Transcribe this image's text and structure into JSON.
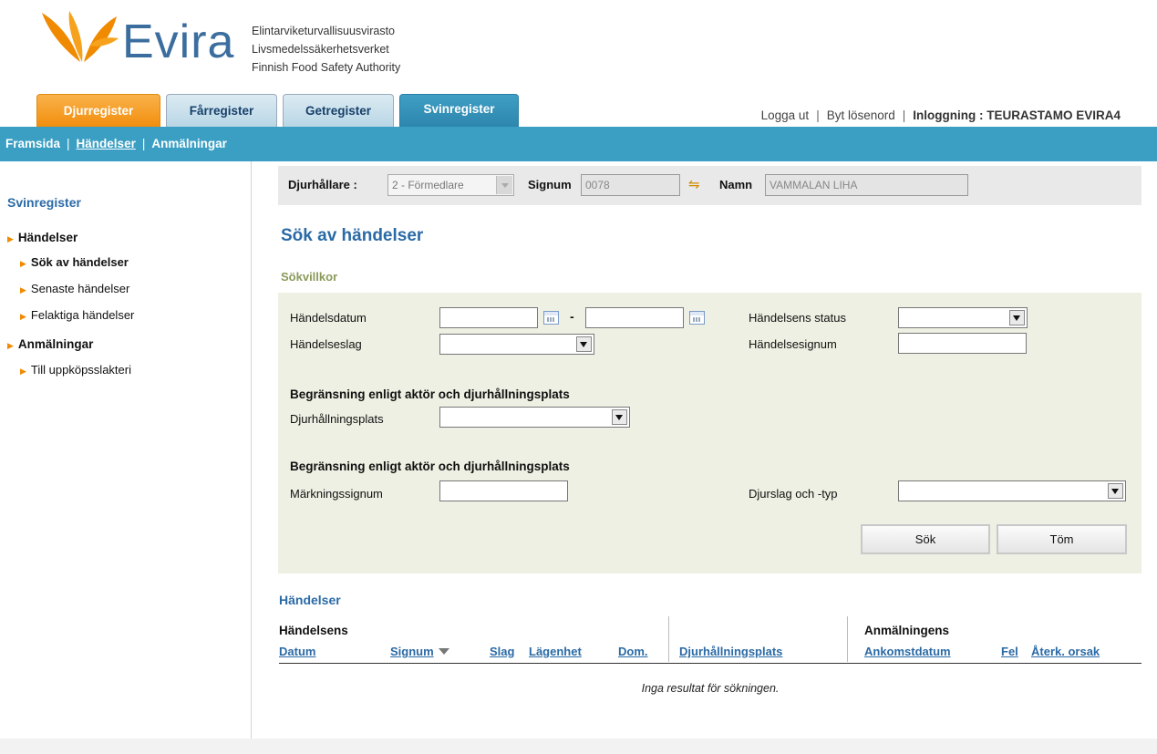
{
  "brand": {
    "logo_text": "Evira",
    "agency_lines": [
      "Elintarviketurvallisuusvirasto",
      "Livsmedelssäkerhetsverket",
      "Finnish Food Safety Authority"
    ],
    "colors": {
      "orange": "#f28e0e",
      "blue": "#3a9fc3",
      "title_blue": "#2a6aa6"
    }
  },
  "tabs": [
    {
      "label": "Djurregister"
    },
    {
      "label": "Fårregister"
    },
    {
      "label": "Getregister"
    },
    {
      "label": "Svinregister",
      "active": true
    }
  ],
  "account": {
    "logout": "Logga ut",
    "change_password": "Byt lösenord",
    "login": "Inloggning : TEURASTAMO EVIRA4"
  },
  "navbar": {
    "items": [
      "Framsida",
      "Händelser",
      "Anmälningar"
    ],
    "current": "Händelser"
  },
  "sidebar": {
    "title": "Svinregister",
    "items": [
      {
        "label": "Händelser",
        "level": 1
      },
      {
        "label": "Sök av händelser",
        "level": 2,
        "selected": true
      },
      {
        "label": "Senaste händelser",
        "level": 2
      },
      {
        "label": "Felaktiga händelser",
        "level": 2
      },
      {
        "label": "Anmälningar",
        "level": 1
      },
      {
        "label": "Till uppköpsslakteri",
        "level": 2
      }
    ]
  },
  "holder": {
    "label": "Djurhållare :",
    "value": "2 - Förmedlare",
    "signum_label": "Signum",
    "signum_value": "0078",
    "name_label": "Namn",
    "name_value": "VAMMALAN LIHA"
  },
  "page": {
    "title": "Sök av händelser",
    "criteria_title": "Sökvillkor"
  },
  "search": {
    "event_date_label": "Händelsdatum",
    "date_separator": "-",
    "event_status_label": "Händelsens status",
    "event_type_label": "Händelseslag",
    "event_signum_label": "Händelsesignum",
    "section1_heading": "Begränsning enligt aktör och djurhållningsplats",
    "holding_label": "Djurhållningsplats",
    "section2_heading": "Begränsning enligt aktör och djurhållningsplats",
    "marking_signum_label": "Märkningssignum",
    "species_label": "Djurslag och -typ",
    "search_button": "Sök",
    "clear_button": "Töm"
  },
  "results": {
    "title": "Händelser",
    "group_event": "Händelsens",
    "group_report": "Anmälningens",
    "columns": [
      "Datum",
      "Signum",
      "Slag",
      "Lägenhet",
      "Dom.",
      "Djurhållningsplats",
      "Ankomstdatum",
      "Fel",
      "Återk. orsak"
    ],
    "empty_message": "Inga resultat för sökningen."
  }
}
